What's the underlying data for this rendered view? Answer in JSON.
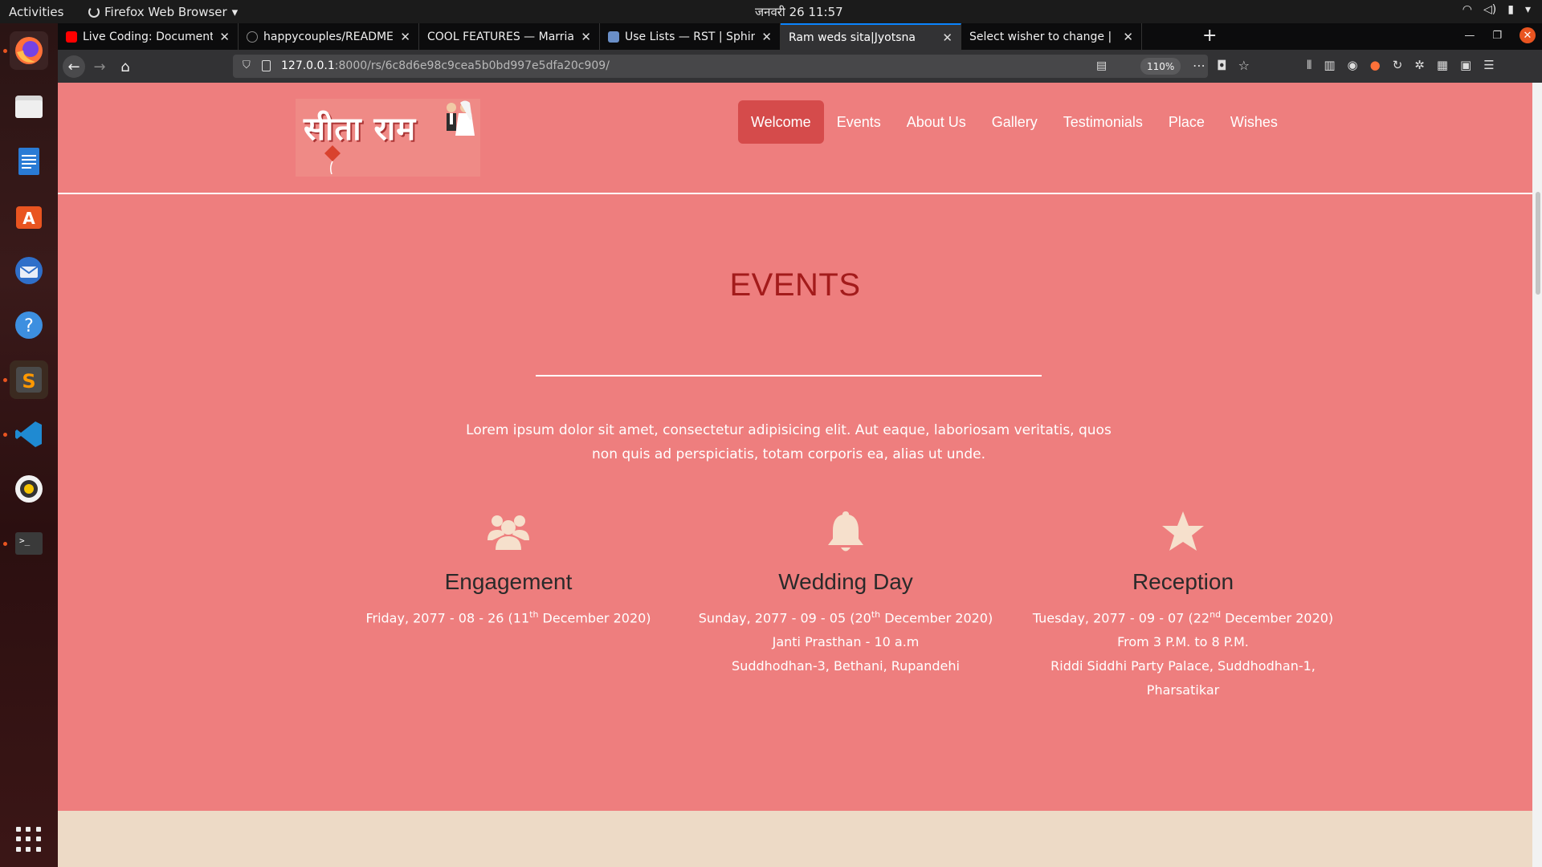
{
  "system": {
    "activities": "Activities",
    "app_menu": "Firefox Web Browser",
    "clock": "जनवरी 26  11:57"
  },
  "browser": {
    "tabs": [
      {
        "label": "Live Coding: Documentat",
        "favicon": "youtube-icon",
        "color": "#ff0000"
      },
      {
        "label": "happycouples/README.",
        "favicon": "github-icon",
        "color": "#333333"
      },
      {
        "label": "COOL FEATURES — Marriag",
        "favicon": "none",
        "color": "#0c0c0d"
      },
      {
        "label": "Use Lists — RST | Sphinx",
        "favicon": "doc-icon",
        "color": "#6a8fc8"
      },
      {
        "label": "Ram weds sita|Jyotsna",
        "favicon": "none",
        "color": "#323234"
      },
      {
        "label": "Select wisher to change | Dj",
        "favicon": "none",
        "color": "#0c0c0d"
      }
    ],
    "active_tab_index": 4,
    "url_host": "127.0.0.1",
    "url_path": ":8000/rs/6c8d6e98c9cea5b0bd997e5dfa20c909/",
    "zoom": "110%"
  },
  "site": {
    "logo_text": "सीता राम",
    "nav": [
      {
        "label": "Welcome",
        "active": true
      },
      {
        "label": "Events",
        "active": false
      },
      {
        "label": "About Us",
        "active": false
      },
      {
        "label": "Gallery",
        "active": false
      },
      {
        "label": "Testimonials",
        "active": false
      },
      {
        "label": "Place",
        "active": false
      },
      {
        "label": "Wishes",
        "active": false
      }
    ]
  },
  "events": {
    "title": "EVENTS",
    "intro": "Lorem ipsum dolor sit amet, consectetur adipisicing elit. Aut eaque, laboriosam veritatis, quos non quis ad perspiciatis, totam corporis ea, alias ut unde.",
    "items": [
      {
        "icon": "users-icon",
        "name": "Engagement",
        "date_prefix": "Friday, 2077 - 08 - 26 (11",
        "date_sup": "th",
        "date_suffix": " December 2020)",
        "lines": []
      },
      {
        "icon": "bell-icon",
        "name": "Wedding Day",
        "date_prefix": "Sunday, 2077 - 09 - 05 (20",
        "date_sup": "th",
        "date_suffix": " December 2020)",
        "lines": [
          "Janti Prasthan - 10 a.m",
          "Suddhodhan-3, Bethani, Rupandehi"
        ]
      },
      {
        "icon": "star-icon",
        "name": "Reception",
        "date_prefix": "Tuesday, 2077 - 09 - 07 (22",
        "date_sup": "nd",
        "date_suffix": " December 2020)",
        "lines": [
          "From 3 P.M. to 8 P.M.",
          "Riddi Siddhi Party Palace, Suddhodhan-1,",
          "Pharsatikar"
        ]
      }
    ]
  },
  "colors": {
    "page_bg": "#ee7e7e",
    "title": "#a31b1b",
    "nav_active": "#d54b4b",
    "icon": "#f6e0cc",
    "next_section": "#eddac6"
  }
}
